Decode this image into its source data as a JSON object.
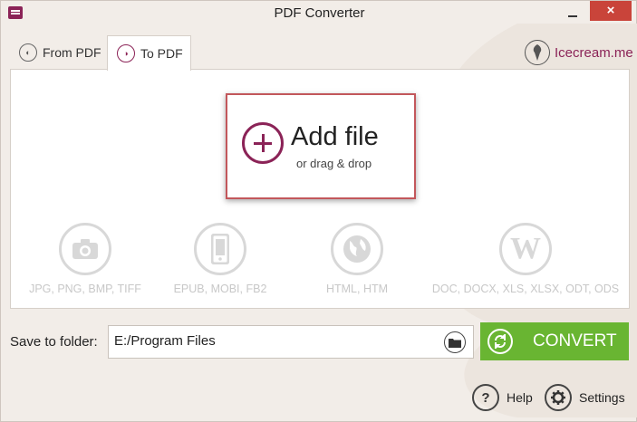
{
  "window": {
    "title": "PDF Converter",
    "close_glyph": "×"
  },
  "tabs": [
    {
      "label": "From PDF",
      "icon": "from-pdf-icon",
      "active": false
    },
    {
      "label": "To PDF",
      "icon": "to-pdf-icon",
      "active": true
    }
  ],
  "brand": {
    "label": "Icecream.me",
    "color": "#8b2357"
  },
  "dropzone": {
    "title": "Add file",
    "subtitle": "or drag & drop"
  },
  "formats": [
    {
      "label": "JPG, PNG, BMP, TIFF",
      "icon": "camera-icon"
    },
    {
      "label": "EPUB, MOBI, FB2",
      "icon": "phone-icon"
    },
    {
      "label": "HTML, HTM",
      "icon": "globe-icon"
    },
    {
      "label": "DOC, DOCX, XLS, XLSX, ODT, ODS",
      "icon": "word-icon"
    }
  ],
  "save": {
    "label": "Save to folder:",
    "path": "E:/Program Files"
  },
  "convert": {
    "label": "CONVERT",
    "color": "#69b532"
  },
  "footer": {
    "help_label": "Help",
    "settings_label": "Settings"
  },
  "colors": {
    "accent": "#8b2357",
    "close": "#c9443a",
    "background": "#f2ede8"
  }
}
